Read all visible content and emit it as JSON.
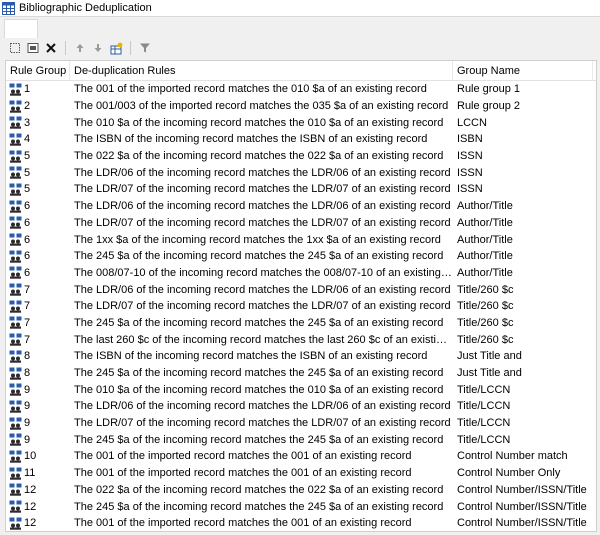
{
  "window": {
    "title": "Bibliographic Deduplication"
  },
  "toolbar": {
    "new_icon": "new-record-icon",
    "properties_icon": "properties-icon",
    "delete_icon": "delete-icon",
    "move_up_icon": "move-up-icon",
    "move_down_icon": "move-down-icon",
    "add_group_icon": "add-group-icon",
    "filter_icon": "filter-icon"
  },
  "grid": {
    "headers": {
      "group": "Rule Group",
      "rule": "De-duplication Rules",
      "name": "Group Name"
    },
    "rows": [
      {
        "group": "1",
        "rule": "The 001 of the imported record matches the 010 $a of an existing record",
        "name": "Rule group 1"
      },
      {
        "group": "2",
        "rule": "The 001/003 of the imported record matches the 035 $a of an existing record",
        "name": "Rule group 2"
      },
      {
        "group": "3",
        "rule": "The 010 $a of the incoming record matches the 010 $a of an existing record",
        "name": "LCCN"
      },
      {
        "group": "4",
        "rule": "The ISBN of the incoming record matches the ISBN of an existing record",
        "name": "ISBN"
      },
      {
        "group": "5",
        "rule": "The 022 $a of the incoming record matches the 022 $a of an existing record",
        "name": "ISSN"
      },
      {
        "group": "5",
        "rule": "The LDR/06 of the incoming record matches the LDR/06 of an existing record",
        "name": "ISSN"
      },
      {
        "group": "5",
        "rule": "The LDR/07 of the incoming record matches the LDR/07 of an existing record",
        "name": "ISSN"
      },
      {
        "group": "6",
        "rule": "The LDR/06 of the incoming record matches the LDR/06 of an existing record",
        "name": "Author/Title"
      },
      {
        "group": "6",
        "rule": "The LDR/07 of the incoming record matches the LDR/07 of an existing record",
        "name": "Author/Title"
      },
      {
        "group": "6",
        "rule": "The 1xx $a of the incoming record matches the 1xx $a of an existing record",
        "name": "Author/Title"
      },
      {
        "group": "6",
        "rule": "The 245 $a of the incoming record matches the 245 $a of an existing record",
        "name": "Author/Title"
      },
      {
        "group": "6",
        "rule": "The 008/07-10 of the incoming record matches the 008/07-10 of an existing rec...",
        "name": "Author/Title"
      },
      {
        "group": "7",
        "rule": "The LDR/06 of the incoming record matches the LDR/06 of an existing record",
        "name": "Title/260 $c"
      },
      {
        "group": "7",
        "rule": "The LDR/07 of the incoming record matches the LDR/07 of an existing record",
        "name": "Title/260 $c"
      },
      {
        "group": "7",
        "rule": "The 245 $a of the incoming record matches the 245 $a of an existing record",
        "name": "Title/260 $c"
      },
      {
        "group": "7",
        "rule": "The last 260 $c of the incoming record matches the last 260 $c of an existing rec...",
        "name": "Title/260 $c"
      },
      {
        "group": "8",
        "rule": "The ISBN of the incoming record matches the ISBN of an existing record",
        "name": "Just Title and"
      },
      {
        "group": "8",
        "rule": "The 245 $a of the incoming record matches the 245 $a of an existing record",
        "name": "Just Title and"
      },
      {
        "group": "9",
        "rule": "The 010 $a of the incoming record matches the 010 $a of an existing record",
        "name": "Title/LCCN"
      },
      {
        "group": "9",
        "rule": "The LDR/06 of the incoming record matches the LDR/06 of an existing record",
        "name": "Title/LCCN"
      },
      {
        "group": "9",
        "rule": "The LDR/07 of the incoming record matches the LDR/07 of an existing record",
        "name": "Title/LCCN"
      },
      {
        "group": "9",
        "rule": "The 245 $a of the incoming record matches the 245 $a of an existing record",
        "name": "Title/LCCN"
      },
      {
        "group": "10",
        "rule": "The 001 of the imported record matches the 001 of an existing record",
        "name": "Control Number match"
      },
      {
        "group": "11",
        "rule": "The 001 of the imported record matches the 001 of an existing record",
        "name": "Control Number Only"
      },
      {
        "group": "12",
        "rule": "The 022 $a of the incoming record matches the 022 $a of an existing record",
        "name": "Control Number/ISSN/Title"
      },
      {
        "group": "12",
        "rule": "The 245 $a of the incoming record matches the 245 $a of an existing record",
        "name": "Control Number/ISSN/Title"
      },
      {
        "group": "12",
        "rule": "The 001 of the imported record matches the 001 of an existing record",
        "name": "Control Number/ISSN/Title"
      }
    ]
  },
  "colors": {
    "accent": "#3c5aa0",
    "icon_blue": "#2a5caa",
    "icon_dark": "#2b2b2b"
  }
}
